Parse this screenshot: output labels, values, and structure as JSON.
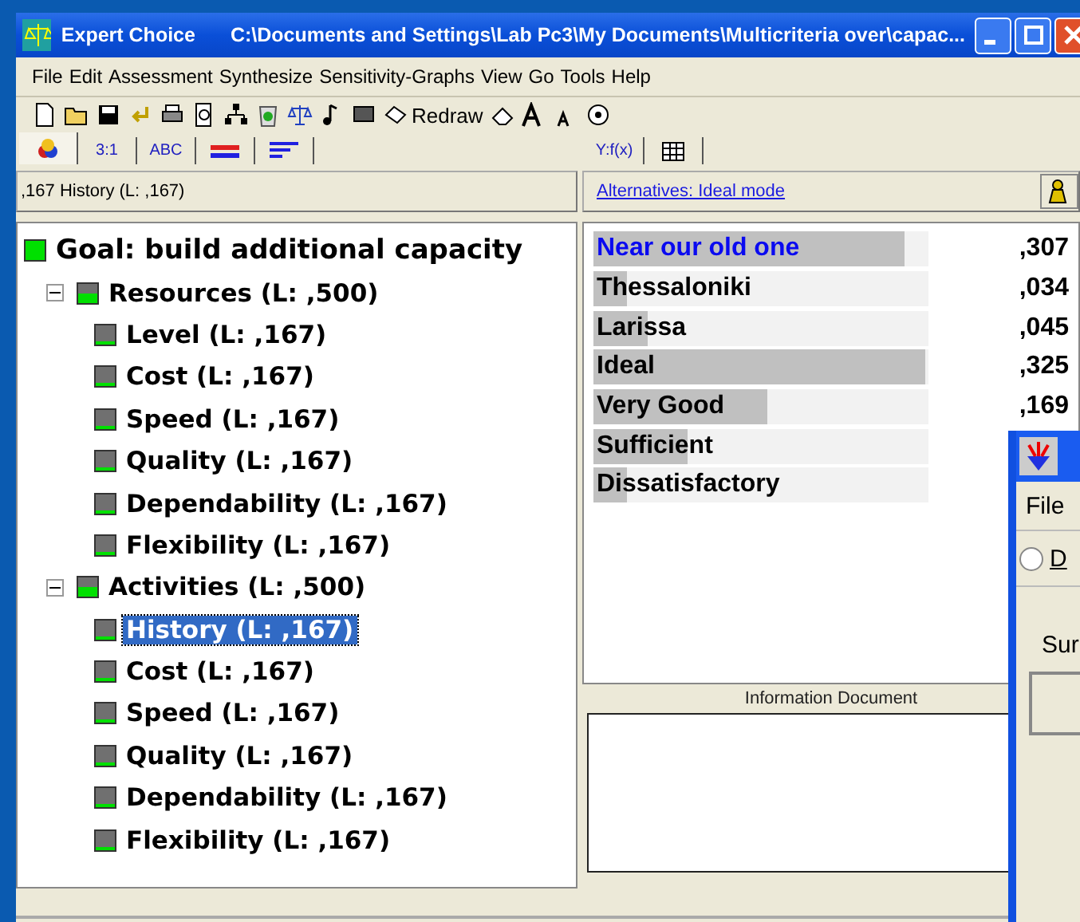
{
  "window": {
    "title": "Expert Choice",
    "path": "C:\\Documents and Settings\\Lab Pc3\\My Documents\\Multicriteria over\\capac..."
  },
  "menu": [
    "File",
    "Edit",
    "Assessment",
    "Synthesize",
    "Sensitivity-Graphs",
    "View",
    "Go",
    "Tools",
    "Help"
  ],
  "toolbar": {
    "redraw": "Redraw"
  },
  "tabs": [
    {
      "kind": "color",
      "selected": true
    },
    {
      "kind": "ratio",
      "label": "3:1",
      "selected": false
    },
    {
      "kind": "abc",
      "label": "ABC",
      "selected": false
    },
    {
      "kind": "equal",
      "selected": false
    },
    {
      "kind": "bars",
      "selected": false
    },
    {
      "kind": "formula",
      "label": "Y:f(x)",
      "selected": false
    },
    {
      "kind": "grid",
      "selected": false
    }
  ],
  "node_header": ",167 History (L: ,167)",
  "alternatives_link": "Alternatives: Ideal mode",
  "tree": {
    "label": "Goal: build additional capacity",
    "kind": "goal",
    "selected": false,
    "children": [
      {
        "label": "Resources (L: ,500)",
        "kind": "criterion",
        "selected": false,
        "expanded": true,
        "children": [
          {
            "label": "Level (L: ,167)",
            "kind": "sub",
            "selected": false
          },
          {
            "label": "Cost (L: ,167)",
            "kind": "sub",
            "selected": false
          },
          {
            "label": "Speed (L: ,167)",
            "kind": "sub",
            "selected": false
          },
          {
            "label": "Quality (L: ,167)",
            "kind": "sub",
            "selected": false
          },
          {
            "label": "Dependability (L: ,167)",
            "kind": "sub",
            "selected": false
          },
          {
            "label": "Flexibility (L: ,167)",
            "kind": "sub",
            "selected": false
          }
        ]
      },
      {
        "label": "Activities (L: ,500)",
        "kind": "criterion",
        "selected": false,
        "expanded": true,
        "children": [
          {
            "label": "History (L: ,167)",
            "kind": "sub",
            "selected": true
          },
          {
            "label": "Cost (L: ,167)",
            "kind": "sub",
            "selected": false
          },
          {
            "label": "Speed (L: ,167)",
            "kind": "sub",
            "selected": false
          },
          {
            "label": "Quality (L: ,167)",
            "kind": "sub",
            "selected": false
          },
          {
            "label": "Dependability (L: ,167)",
            "kind": "sub",
            "selected": false
          },
          {
            "label": "Flexibility (L: ,167)",
            "kind": "sub",
            "selected": false
          }
        ]
      }
    ]
  },
  "alternatives": [
    {
      "name": "Near our old one",
      "value": ",307",
      "level": 0.93,
      "selected": true
    },
    {
      "name": "Thessaloniki",
      "value": ",034",
      "level": 0.1,
      "selected": false
    },
    {
      "name": "Larissa",
      "value": ",045",
      "level": 0.16,
      "selected": false
    },
    {
      "name": "Ideal",
      "value": ",325",
      "level": 0.99,
      "selected": false
    },
    {
      "name": "Very Good",
      "value": ",169",
      "level": 0.52,
      "selected": false
    },
    {
      "name": "Sufficient",
      "level": 0.28,
      "selected": false
    },
    {
      "name": "Dissatisfactory",
      "level": 0.1,
      "selected": false
    }
  ],
  "info_title": "Information Document",
  "dialog": {
    "menu": "File",
    "radio": {
      "label": "D",
      "checked": false
    },
    "label": "Sur"
  }
}
